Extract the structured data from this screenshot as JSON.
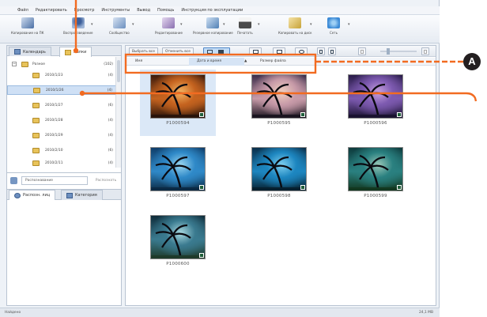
{
  "menu": [
    "Файл",
    "Редактировать",
    "Просмотр",
    "Инструменты",
    "Вывод",
    "Помощь",
    "Инструкция по эксплуатации"
  ],
  "toolbar": [
    {
      "label": "Копирование на ПК",
      "icon": "import-icon",
      "color": "#4a6fa5"
    },
    {
      "label": "Воспроизведение",
      "icon": "person-play-icon",
      "color": "#3d5f9a"
    },
    {
      "label": "Сообщество",
      "icon": "share-icon",
      "color": "#6b8fbf"
    },
    {
      "label": "Редактирование",
      "icon": "edit-icon",
      "color": "#8a6fb0"
    },
    {
      "label": "Резервное копирование",
      "icon": "backup-icon",
      "color": "#4f7fb5"
    },
    {
      "label": "Печатать",
      "icon": "printer-icon",
      "color": "#4b4b4b"
    },
    {
      "label": "Копировать на диск",
      "icon": "disc-copy-icon",
      "color": "#c7a337"
    },
    {
      "label": "Сеть",
      "icon": "globe-icon",
      "color": "#3c8ad6"
    }
  ],
  "left_tabs": {
    "calendar": "Календарь",
    "folders": "Папки"
  },
  "tree": {
    "root": {
      "label": "Разное",
      "count": "(102)"
    },
    "items": [
      {
        "label": "2010/1/23",
        "count": "(4)"
      },
      {
        "label": "2010/1/26",
        "count": "(4)"
      },
      {
        "label": "2010/1/27",
        "count": "(6)"
      },
      {
        "label": "2010/1/28",
        "count": "(4)"
      },
      {
        "label": "2010/1/29",
        "count": "(4)"
      },
      {
        "label": "2010/2/10",
        "count": "(6)"
      },
      {
        "label": "2010/2/11",
        "count": "(4)"
      }
    ]
  },
  "search": {
    "placeholder": "Распознавание",
    "button": "Распознать"
  },
  "bottom_tabs": {
    "tab1": "Распозн. лиц",
    "tab2": "Категория"
  },
  "main_toolbar": {
    "select_all": "Выбрать все",
    "deselect": "Отменить все"
  },
  "sortbar": {
    "name": "Имя",
    "date": "Дата и время",
    "size": "Размер файла"
  },
  "photos": [
    {
      "caption": "P1000594",
      "colors": [
        "#3b1a0c",
        "#c5631f",
        "#f3b463",
        "#2a140a"
      ],
      "selected": true
    },
    {
      "caption": "P1000595",
      "colors": [
        "#3a2d4a",
        "#c79aa8",
        "#f0d0c0",
        "#1b1520"
      ],
      "selected": false
    },
    {
      "caption": "P1000596",
      "colors": [
        "#2a1c4a",
        "#7d5ab0",
        "#c8a2e0",
        "#1a1230"
      ],
      "selected": false
    },
    {
      "caption": "P1000597",
      "colors": [
        "#0f3e6a",
        "#2f89c8",
        "#9ad6f0",
        "#0b2a45"
      ],
      "selected": false
    },
    {
      "caption": "P1000598",
      "colors": [
        "#0a2f4a",
        "#1d86c0",
        "#7fd0f0",
        "#06202f"
      ],
      "selected": false
    },
    {
      "caption": "P1000599",
      "colors": [
        "#0d3a3c",
        "#2a8080",
        "#9ac8b8",
        "#133820"
      ],
      "selected": false
    },
    {
      "caption": "P1000600",
      "colors": [
        "#0f2c3a",
        "#3a7a8f",
        "#a8d8e0",
        "#1e3a2a"
      ],
      "selected": false
    }
  ],
  "status": {
    "left": "Найдено",
    "right": "24,1 MB"
  },
  "annotation": {
    "letter": "A"
  }
}
